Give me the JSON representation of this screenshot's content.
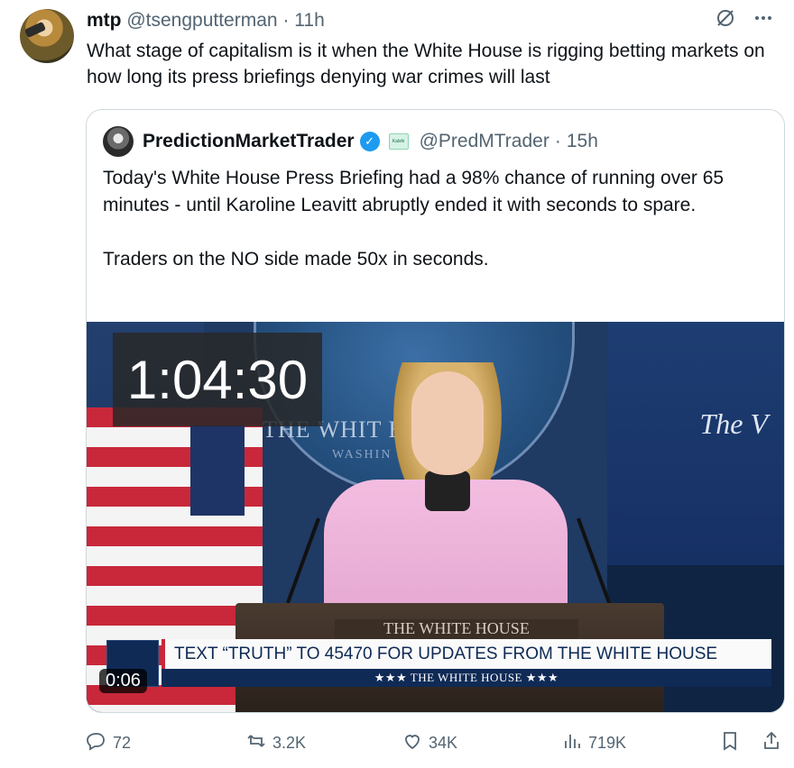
{
  "tweet": {
    "name": "mtp",
    "handle": "@tsengputterman",
    "separator": "·",
    "time": "11h",
    "text": "What stage of capitalism is it when the White House is rigging betting markets on how long its press briefings denying war crimes will last",
    "icons": [
      "grok-icon",
      "more-icon"
    ]
  },
  "quote": {
    "name": "PredictionMarketTrader",
    "verified": true,
    "affiliate_badge": "Kalshi",
    "handle": "@PredMTrader",
    "separator": "·",
    "time": "15h",
    "paragraph1": "Today's White House Press Briefing had a 98% chance of running over 65 minutes - until Karoline Leavitt abruptly ended it with seconds to spare.",
    "paragraph2": "Traders on the NO side made 50x in seconds.",
    "media": {
      "timer": "1:04:30",
      "seal_text": "THE WHIT    E",
      "seal_subtext": "WASHIN",
      "right_screen_text": "The V",
      "podium_text": "THE WHITE HOUSE",
      "ticker": "TEXT “TRUTH” TO 45470 FOR UPDATES FROM THE WHITE HOUSE",
      "ticker_sub": "★★★  THE WHITE HOUSE  ★★★",
      "duration": "0:06"
    }
  },
  "actions": {
    "replies": "72",
    "reposts": "3.2K",
    "likes": "34K",
    "views": "719K"
  },
  "colors": {
    "secondary_text": "#536471",
    "verified_blue": "#1d9bf0",
    "border": "#cfd9de"
  }
}
